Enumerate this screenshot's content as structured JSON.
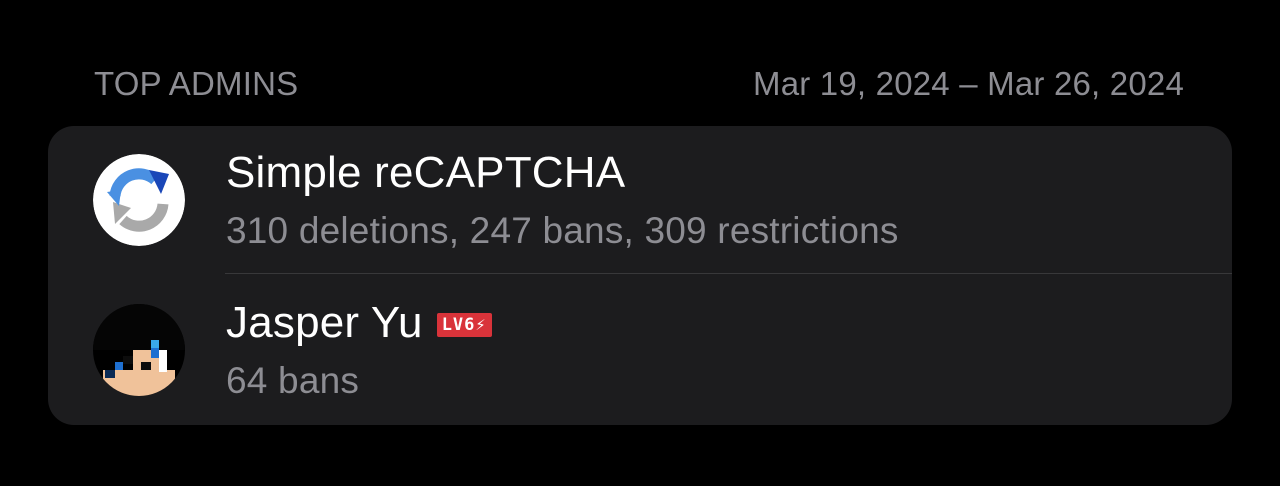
{
  "header": {
    "section_title": "TOP ADMINS",
    "date_range": "Mar 19, 2024 – Mar 26, 2024"
  },
  "admins": [
    {
      "name": "Simple reCAPTCHA",
      "stats": "310 deletions, 247 bans, 309 restrictions",
      "avatar_icon": "recaptcha-logo-icon"
    },
    {
      "name": "Jasper Yu",
      "badge": "LV6⚡",
      "stats": "64 bans",
      "avatar_icon": "pixel-character-avatar"
    }
  ],
  "colors": {
    "background": "#000000",
    "card": "#1c1c1e",
    "primary_text": "#ffffff",
    "secondary_text": "#8d8d93",
    "badge": "#d9333a"
  }
}
